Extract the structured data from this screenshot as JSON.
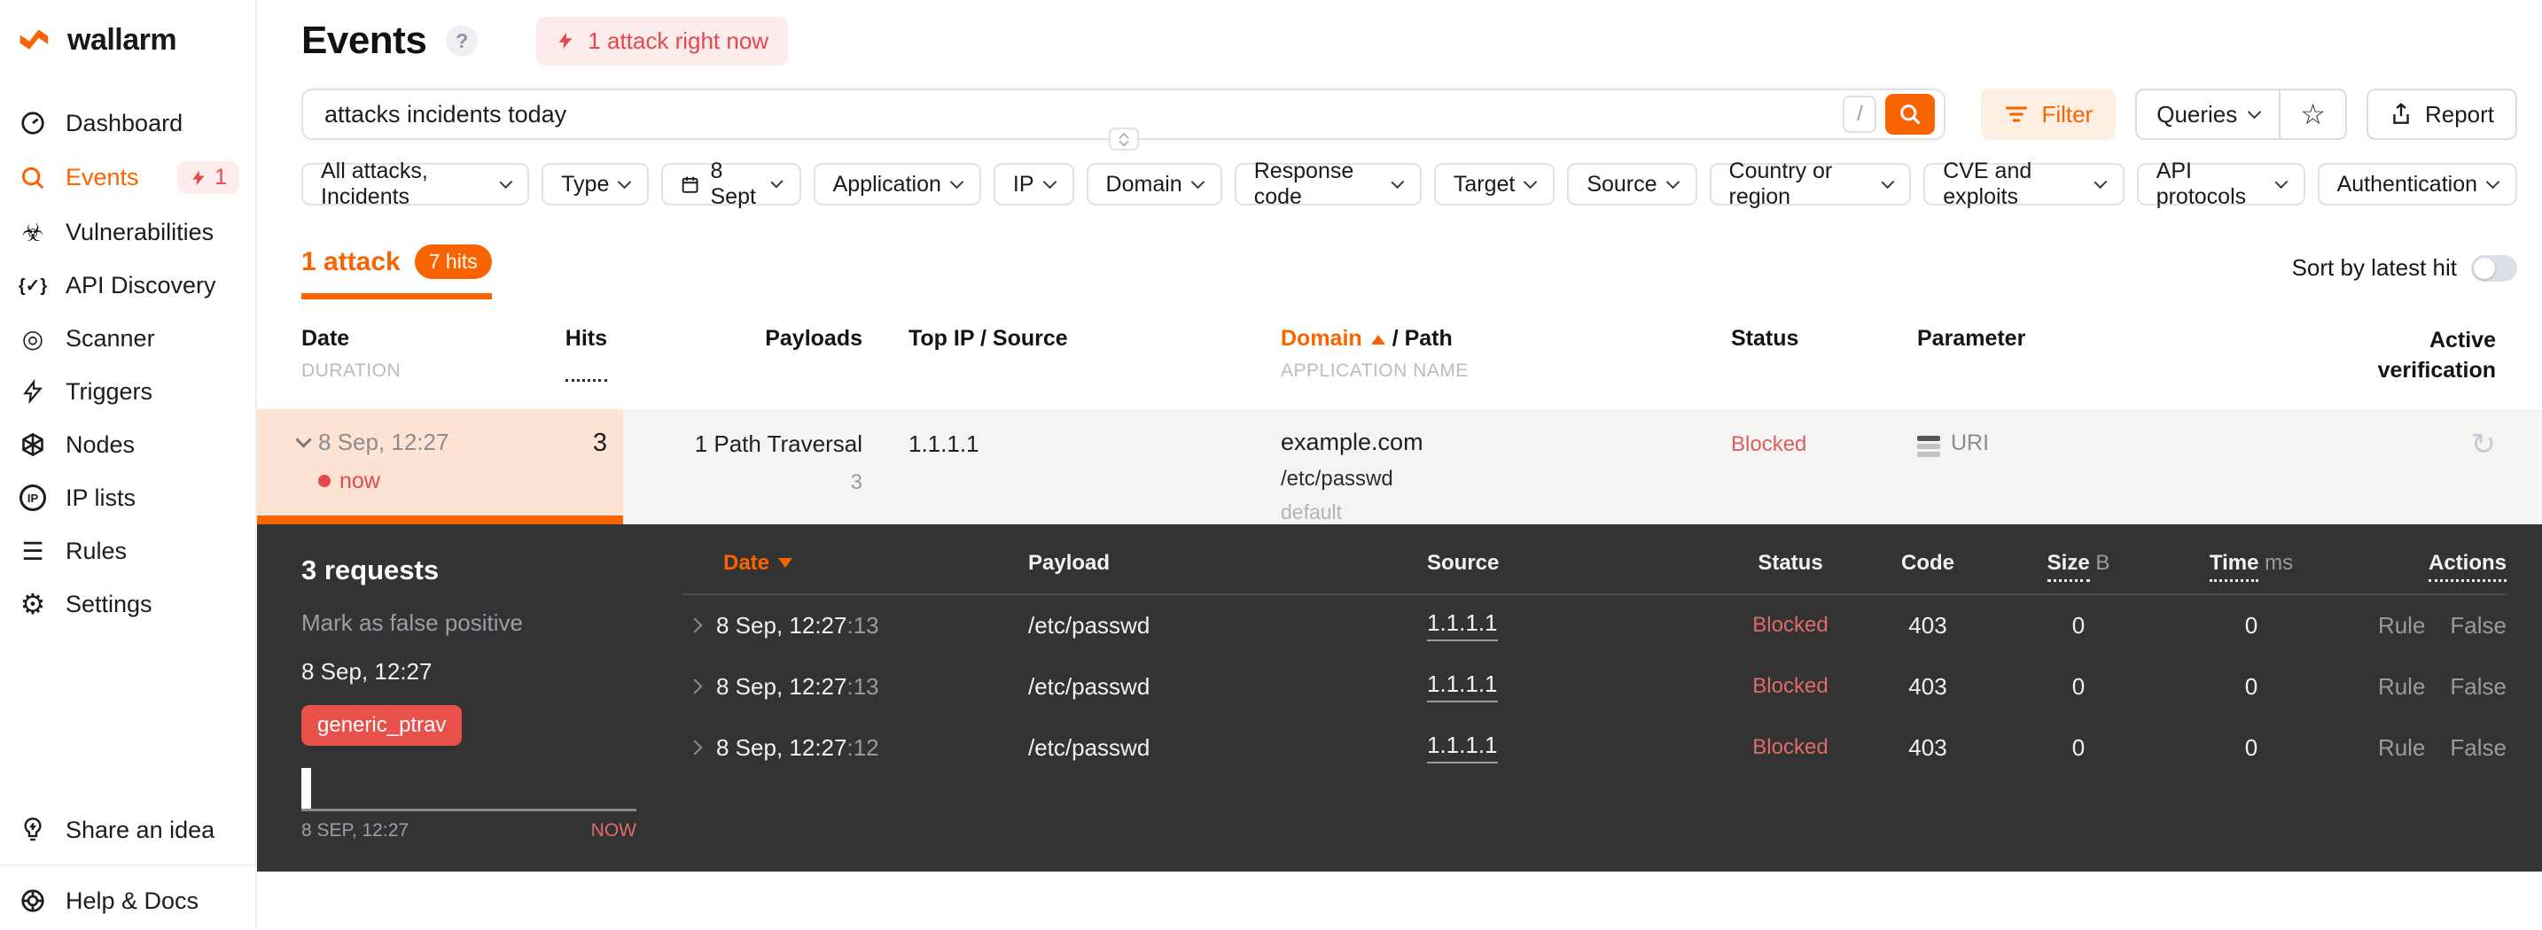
{
  "colors": {
    "accent": "#fa6400",
    "danger": "#e5484d",
    "panel_bg": "#333333",
    "blocked_light": "#d95f5f",
    "blocked_dark": "#e06b6b"
  },
  "icons": {
    "help": "?",
    "star": "☆",
    "vulnerabilities": "☣",
    "api_discovery": "{✓}",
    "scanner": "◎",
    "rules": "☰",
    "settings": "⚙",
    "ip": "IP",
    "active_verification": "↻"
  },
  "sidebar": {
    "logo_text": "wallarm",
    "items": [
      {
        "label": "Dashboard"
      },
      {
        "label": "Events",
        "badge": "1"
      },
      {
        "label": "Vulnerabilities"
      },
      {
        "label": "API Discovery"
      },
      {
        "label": "Scanner"
      },
      {
        "label": "Triggers"
      },
      {
        "label": "Nodes"
      },
      {
        "label": "IP lists"
      },
      {
        "label": "Rules"
      },
      {
        "label": "Settings"
      }
    ],
    "footer_items": [
      {
        "label": "Share an idea"
      },
      {
        "label": "Help & Docs"
      }
    ]
  },
  "header": {
    "title": "Events",
    "attack_banner": "1 attack right now"
  },
  "search": {
    "value": "attacks incidents today",
    "shortcut": "/"
  },
  "toolbar": {
    "filter_label": "Filter",
    "queries_label": "Queries",
    "report_label": "Report"
  },
  "filters": [
    {
      "label": "All attacks, Incidents"
    },
    {
      "label": "Type"
    },
    {
      "label": "8 Sept"
    },
    {
      "label": "Application"
    },
    {
      "label": "IP"
    },
    {
      "label": "Domain"
    },
    {
      "label": "Response code"
    },
    {
      "label": "Target"
    },
    {
      "label": "Source"
    },
    {
      "label": "Country or region"
    },
    {
      "label": "CVE and exploits"
    },
    {
      "label": "API protocols"
    },
    {
      "label": "Authentication"
    }
  ],
  "results": {
    "tab_label": "1 attack",
    "hits_badge": "7 hits",
    "sort_label": "Sort by latest hit"
  },
  "attacks_table": {
    "headers": {
      "date": "Date",
      "duration": "DURATION",
      "hits": "Hits",
      "payloads": "Payloads",
      "top_ip": "Top IP / Source",
      "domain": "Domain",
      "path": "/ Path",
      "application": "APPLICATION NAME",
      "status": "Status",
      "parameter": "Parameter",
      "active_verification": "Active verification"
    },
    "row": {
      "date": "8 Sep, 12:27",
      "live": "now",
      "hits": "3",
      "payload_type": "1 Path Traversal",
      "payload_count": "3",
      "top_ip": "1.1.1.1",
      "domain": "example.com",
      "path": "/etc/passwd",
      "application": "default",
      "status": "Blocked",
      "parameter": "URI"
    }
  },
  "detail_panel": {
    "title": "3 requests",
    "false_positive_label": "Mark as false positive",
    "date": "8 Sep, 12:27",
    "tag": "generic_ptrav",
    "timeline": {
      "start": "8 SEP, 12:27",
      "end": "NOW"
    },
    "table": {
      "headers": {
        "date": "Date",
        "payload": "Payload",
        "source": "Source",
        "status": "Status",
        "code": "Code",
        "size": "Size",
        "size_unit": "B",
        "time": "Time",
        "time_unit": "ms",
        "actions": "Actions"
      },
      "rows": [
        {
          "date": "8 Sep, 12:27",
          "seconds": ":13",
          "payload": "/etc/passwd",
          "source": "1.1.1.1",
          "status": "Blocked",
          "code": "403",
          "size": "0",
          "time": "0",
          "rule": "Rule",
          "false": "False"
        },
        {
          "date": "8 Sep, 12:27",
          "seconds": ":13",
          "payload": "/etc/passwd",
          "source": "1.1.1.1",
          "status": "Blocked",
          "code": "403",
          "size": "0",
          "time": "0",
          "rule": "Rule",
          "false": "False"
        },
        {
          "date": "8 Sep, 12:27",
          "seconds": ":12",
          "payload": "/etc/passwd",
          "source": "1.1.1.1",
          "status": "Blocked",
          "code": "403",
          "size": "0",
          "time": "0",
          "rule": "Rule",
          "false": "False"
        }
      ]
    }
  }
}
